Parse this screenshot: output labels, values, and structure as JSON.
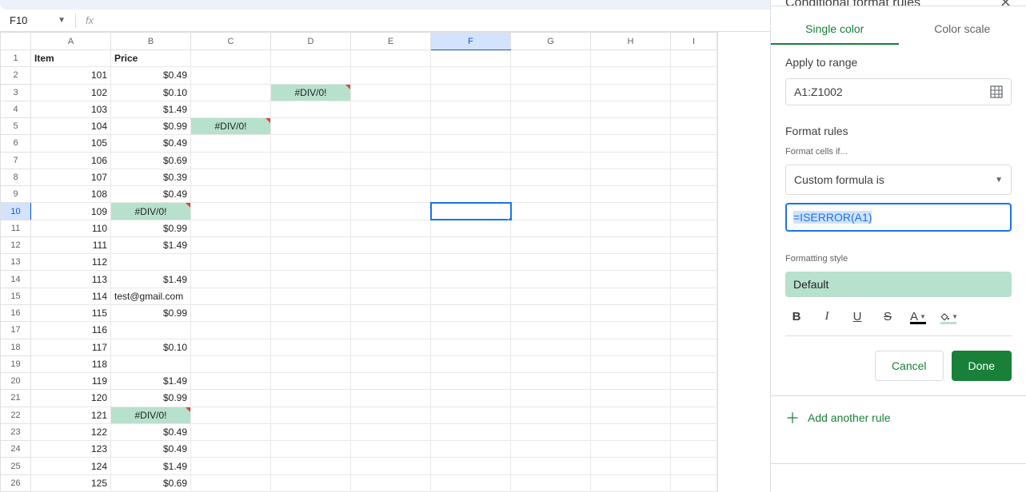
{
  "formula_bar": {
    "name_box": "F10",
    "fx": "fx",
    "value": ""
  },
  "columns": [
    "A",
    "B",
    "C",
    "D",
    "E",
    "F",
    "G",
    "H",
    "I"
  ],
  "rows": [
    {
      "n": 1,
      "A": {
        "v": "Item",
        "align": "left",
        "bold": true
      },
      "B": {
        "v": "Price",
        "align": "left",
        "bold": true
      }
    },
    {
      "n": 2,
      "A": {
        "v": "101"
      },
      "B": {
        "v": "$0.49"
      }
    },
    {
      "n": 3,
      "A": {
        "v": "102"
      },
      "B": {
        "v": "$0.10"
      },
      "D": {
        "v": "#DIV/0!",
        "cf": true,
        "flag": true,
        "center": true
      }
    },
    {
      "n": 4,
      "A": {
        "v": "103"
      },
      "B": {
        "v": "$1.49"
      }
    },
    {
      "n": 5,
      "A": {
        "v": "104"
      },
      "B": {
        "v": "$0.99"
      },
      "C": {
        "v": "#DIV/0!",
        "cf": true,
        "flag": true,
        "center": true
      }
    },
    {
      "n": 6,
      "A": {
        "v": "105"
      },
      "B": {
        "v": "$0.49"
      }
    },
    {
      "n": 7,
      "A": {
        "v": "106"
      },
      "B": {
        "v": "$0.69"
      }
    },
    {
      "n": 8,
      "A": {
        "v": "107"
      },
      "B": {
        "v": "$0.39"
      }
    },
    {
      "n": 9,
      "A": {
        "v": "108"
      },
      "B": {
        "v": "$0.49"
      }
    },
    {
      "n": 10,
      "A": {
        "v": "109"
      },
      "B": {
        "v": "#DIV/0!",
        "cf": true,
        "flag": true,
        "center": true
      },
      "F": {
        "selected": true
      }
    },
    {
      "n": 11,
      "A": {
        "v": "110"
      },
      "B": {
        "v": "$0.99"
      }
    },
    {
      "n": 12,
      "A": {
        "v": "111"
      },
      "B": {
        "v": "$1.49"
      }
    },
    {
      "n": 13,
      "A": {
        "v": "112"
      }
    },
    {
      "n": 14,
      "A": {
        "v": "113"
      },
      "B": {
        "v": "$1.49"
      }
    },
    {
      "n": 15,
      "A": {
        "v": "114"
      },
      "B": {
        "v": "test@gmail.com",
        "align": "left"
      }
    },
    {
      "n": 16,
      "A": {
        "v": "115"
      },
      "B": {
        "v": "$0.99"
      }
    },
    {
      "n": 17,
      "A": {
        "v": "116"
      }
    },
    {
      "n": 18,
      "A": {
        "v": "117"
      },
      "B": {
        "v": "$0.10"
      }
    },
    {
      "n": 19,
      "A": {
        "v": "118"
      }
    },
    {
      "n": 20,
      "A": {
        "v": "119"
      },
      "B": {
        "v": "$1.49"
      }
    },
    {
      "n": 21,
      "A": {
        "v": "120"
      },
      "B": {
        "v": "$0.99"
      }
    },
    {
      "n": 22,
      "A": {
        "v": "121"
      },
      "B": {
        "v": "#DIV/0!",
        "cf": true,
        "flag": true,
        "center": true
      }
    },
    {
      "n": 23,
      "A": {
        "v": "122"
      },
      "B": {
        "v": "$0.49"
      }
    },
    {
      "n": 24,
      "A": {
        "v": "123"
      },
      "B": {
        "v": "$0.49"
      }
    },
    {
      "n": 25,
      "A": {
        "v": "124"
      },
      "B": {
        "v": "$1.49"
      }
    },
    {
      "n": 26,
      "A": {
        "v": "125"
      },
      "B": {
        "v": "$0.69"
      }
    }
  ],
  "panel": {
    "title": "Conditional format rules",
    "tabs": {
      "single": "Single color",
      "scale": "Color scale"
    },
    "apply_label": "Apply to range",
    "range": "A1:Z1002",
    "format_rules_label": "Format rules",
    "format_cells_if_label": "Format cells if...",
    "condition": "Custom formula is",
    "formula": "=ISERROR(A1)",
    "formatting_style_label": "Formatting style",
    "style_name": "Default",
    "cancel": "Cancel",
    "done": "Done",
    "add_rule": "Add another rule"
  },
  "selection": {
    "col": "F",
    "row": 10
  },
  "colors": {
    "cf_bg": "#b7e1cd",
    "primary": "#188038",
    "sel": "#1a73e8"
  }
}
